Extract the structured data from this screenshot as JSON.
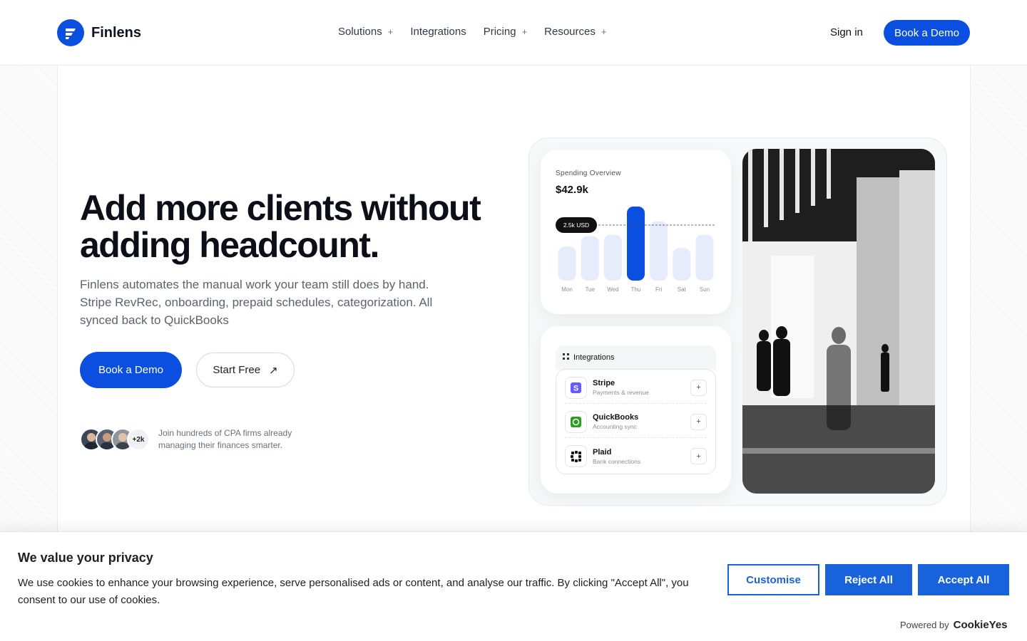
{
  "brand": {
    "name": "Finlens",
    "accent": "#0b4fe0"
  },
  "nav": {
    "items": [
      {
        "label": "Solutions",
        "has_dropdown": true
      },
      {
        "label": "Integrations",
        "has_dropdown": false
      },
      {
        "label": "Pricing",
        "has_dropdown": true
      },
      {
        "label": "Resources",
        "has_dropdown": true
      }
    ],
    "dropdown_icon": "+",
    "signin_label": "Sign in",
    "cta_label": "Book a Demo"
  },
  "hero": {
    "title": "Add more clients without adding headcount.",
    "subtitle": "Finlens automates the manual work your team still does by hand. Stripe RevRec, onboarding, prepaid schedules, categorization. All synced back to QuickBooks",
    "primary_cta": "Book a Demo",
    "secondary_cta": "Start Free",
    "secondary_icon": "↗",
    "social_count": "+2k",
    "social_text": "Join hundreds of CPA firms already managing their finances smarter."
  },
  "spending_card": {
    "label": "Spending Overview",
    "amount": "$42.9k",
    "tooltip": "2.5k USD"
  },
  "chart_data": {
    "type": "bar",
    "categories": [
      "Mon",
      "Tue",
      "Wed",
      "Thu",
      "Fri",
      "Sat",
      "Sun"
    ],
    "values": [
      0.46,
      0.6,
      0.62,
      1.0,
      0.8,
      0.44,
      0.62
    ],
    "highlight_index": 3,
    "reference_line_label": "2.5k USD",
    "reference_line_value": 0.75,
    "bar_color": "#e5edfd",
    "highlight_color": "#0b4fe0",
    "grid": false
  },
  "integrations": {
    "title": "Integrations",
    "items": [
      {
        "name": "Stripe",
        "desc": "Payments & revenue",
        "icon": "stripe-icon",
        "color": "#635bff"
      },
      {
        "name": "QuickBooks",
        "desc": "Accounting sync",
        "icon": "quickbooks-icon",
        "color": "#2ca01c"
      },
      {
        "name": "Plaid",
        "desc": "Bank connections",
        "icon": "plaid-icon",
        "color": "#111111"
      }
    ],
    "add_label": "+"
  },
  "cookie": {
    "title": "We value your privacy",
    "text": "We use cookies to enhance your browsing experience, serve personalised ads or content, and analyse our traffic. By clicking \"Accept All\", you consent to our use of cookies.",
    "customise": "Customise",
    "reject": "Reject All",
    "accept": "Accept All",
    "powered_by": "Powered by",
    "powered_brand": "CookieYes",
    "button_color": "#1863dc"
  }
}
